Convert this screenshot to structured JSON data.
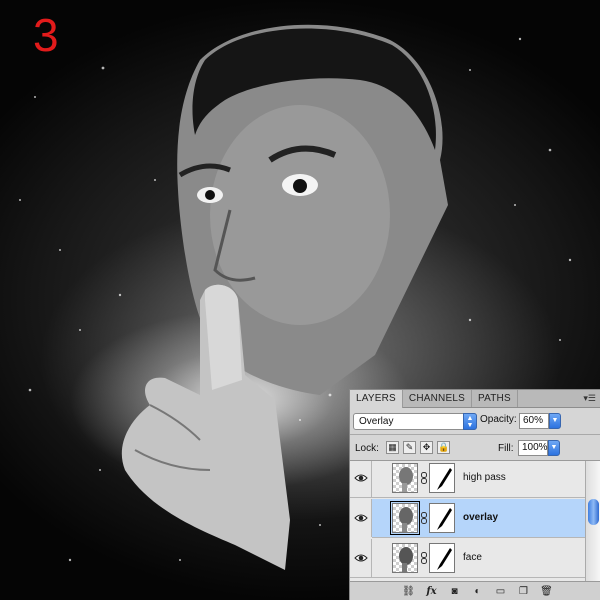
{
  "canvas": {
    "step_number": "3",
    "step_color": "#e21b1b"
  },
  "layers_panel": {
    "tabs": [
      {
        "label": "LAYERS",
        "active": true
      },
      {
        "label": "CHANNELS",
        "active": false
      },
      {
        "label": "PATHS",
        "active": false
      }
    ],
    "menu_icon": "panel-menu-icon",
    "blend_mode": "Overlay",
    "opacity_label": "Opacity:",
    "opacity_value": "60%",
    "lock_label": "Lock:",
    "lock_icons": [
      "lock-transparent-icon",
      "lock-image-icon",
      "lock-position-icon",
      "lock-all-icon"
    ],
    "fill_label": "Fill:",
    "fill_value": "100%",
    "layers": [
      {
        "name": "high pass",
        "visible": true,
        "selected": false
      },
      {
        "name": "overlay",
        "visible": true,
        "selected": true
      },
      {
        "name": "face",
        "visible": true,
        "selected": false
      }
    ],
    "bottom_icons": [
      "link-layers-icon",
      "fx-icon",
      "add-mask-icon",
      "adjustment-layer-icon",
      "new-group-icon",
      "new-layer-icon",
      "trash-icon"
    ],
    "fx_label": "fx",
    "selection_color": "#b5d5fa"
  }
}
